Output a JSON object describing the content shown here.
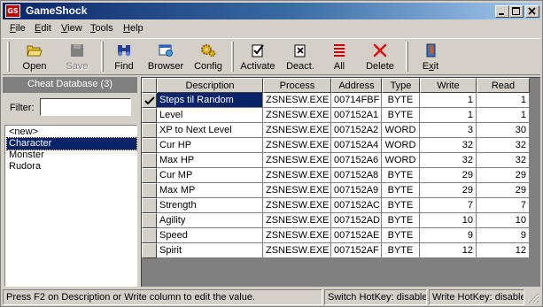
{
  "window": {
    "title": "GameShock",
    "icon_text": "GS",
    "controls": [
      "minimize-icon",
      "maximize-icon",
      "close-icon"
    ]
  },
  "menu": [
    {
      "label": "File",
      "accel": "F",
      "rest": "ile"
    },
    {
      "label": "Edit",
      "accel": "E",
      "rest": "dit"
    },
    {
      "label": "View",
      "accel": "V",
      "rest": "iew"
    },
    {
      "label": "Tools",
      "accel": "T",
      "rest": "ools"
    },
    {
      "label": "Help",
      "accel": "H",
      "rest": "elp"
    }
  ],
  "toolbar": {
    "open": {
      "label": "Open",
      "icon": "folder-open-icon"
    },
    "save": {
      "label": "Save",
      "icon": "save-icon",
      "disabled": true
    },
    "find": {
      "label": "Find",
      "icon": "binoculars-icon"
    },
    "browser": {
      "label": "Browser",
      "icon": "browser-icon"
    },
    "config": {
      "label": "Config",
      "icon": "gears-icon"
    },
    "activate": {
      "label": "Activate",
      "icon": "activate-icon"
    },
    "deactivate": {
      "label": "Deact.",
      "icon": "deactivate-icon"
    },
    "all": {
      "label": "All",
      "icon": "all-list-icon"
    },
    "delete": {
      "label": "Delete",
      "icon": "delete-x-icon"
    },
    "exit": {
      "label": "Exit",
      "accel": "x",
      "pre": "E",
      "post": "it",
      "icon": "exit-door-icon"
    }
  },
  "cheat_db": {
    "header": "Cheat Database (3)",
    "filter_label": "Filter:",
    "filter_value": "",
    "items": [
      {
        "label": "<new>",
        "selected": false
      },
      {
        "label": "Character",
        "selected": true
      },
      {
        "label": "Monster",
        "selected": false
      },
      {
        "label": "Rudora",
        "selected": false
      }
    ]
  },
  "grid": {
    "columns": [
      "Description",
      "Process",
      "Address",
      "Type",
      "Write",
      "Read"
    ],
    "rows": [
      {
        "active": true,
        "selected": true,
        "description": "Steps til Random",
        "process": "ZSNESW.EXE",
        "address": "00714FBF",
        "type": "BYTE",
        "write": "1",
        "read": "1"
      },
      {
        "active": false,
        "selected": false,
        "description": "Level",
        "process": "ZSNESW.EXE",
        "address": "007152A1",
        "type": "BYTE",
        "write": "1",
        "read": "1"
      },
      {
        "active": false,
        "selected": false,
        "description": "XP to Next Level",
        "process": "ZSNESW.EXE",
        "address": "007152A2",
        "type": "WORD",
        "write": "3",
        "read": "30"
      },
      {
        "active": false,
        "selected": false,
        "description": "Cur HP",
        "process": "ZSNESW.EXE",
        "address": "007152A4",
        "type": "WORD",
        "write": "32",
        "read": "32"
      },
      {
        "active": false,
        "selected": false,
        "description": "Max HP",
        "process": "ZSNESW.EXE",
        "address": "007152A6",
        "type": "WORD",
        "write": "32",
        "read": "32"
      },
      {
        "active": false,
        "selected": false,
        "description": "Cur MP",
        "process": "ZSNESW.EXE",
        "address": "007152A8",
        "type": "BYTE",
        "write": "29",
        "read": "29"
      },
      {
        "active": false,
        "selected": false,
        "description": "Max MP",
        "process": "ZSNESW.EXE",
        "address": "007152A9",
        "type": "BYTE",
        "write": "29",
        "read": "29"
      },
      {
        "active": false,
        "selected": false,
        "description": "Strength",
        "process": "ZSNESW.EXE",
        "address": "007152AC",
        "type": "BYTE",
        "write": "7",
        "read": "7"
      },
      {
        "active": false,
        "selected": false,
        "description": "Agility",
        "process": "ZSNESW.EXE",
        "address": "007152AD",
        "type": "BYTE",
        "write": "10",
        "read": "10"
      },
      {
        "active": false,
        "selected": false,
        "description": "Speed",
        "process": "ZSNESW.EXE",
        "address": "007152AE",
        "type": "BYTE",
        "write": "9",
        "read": "9"
      },
      {
        "active": false,
        "selected": false,
        "description": "Spirit",
        "process": "ZSNESW.EXE",
        "address": "007152AF",
        "type": "BYTE",
        "write": "12",
        "read": "12"
      }
    ]
  },
  "status": {
    "hint": "Press F2 on Description or Write column to edit the value.",
    "switch_hotkey": "Switch HotKey: disable",
    "write_hotkey": "Write HotKey: disable"
  }
}
